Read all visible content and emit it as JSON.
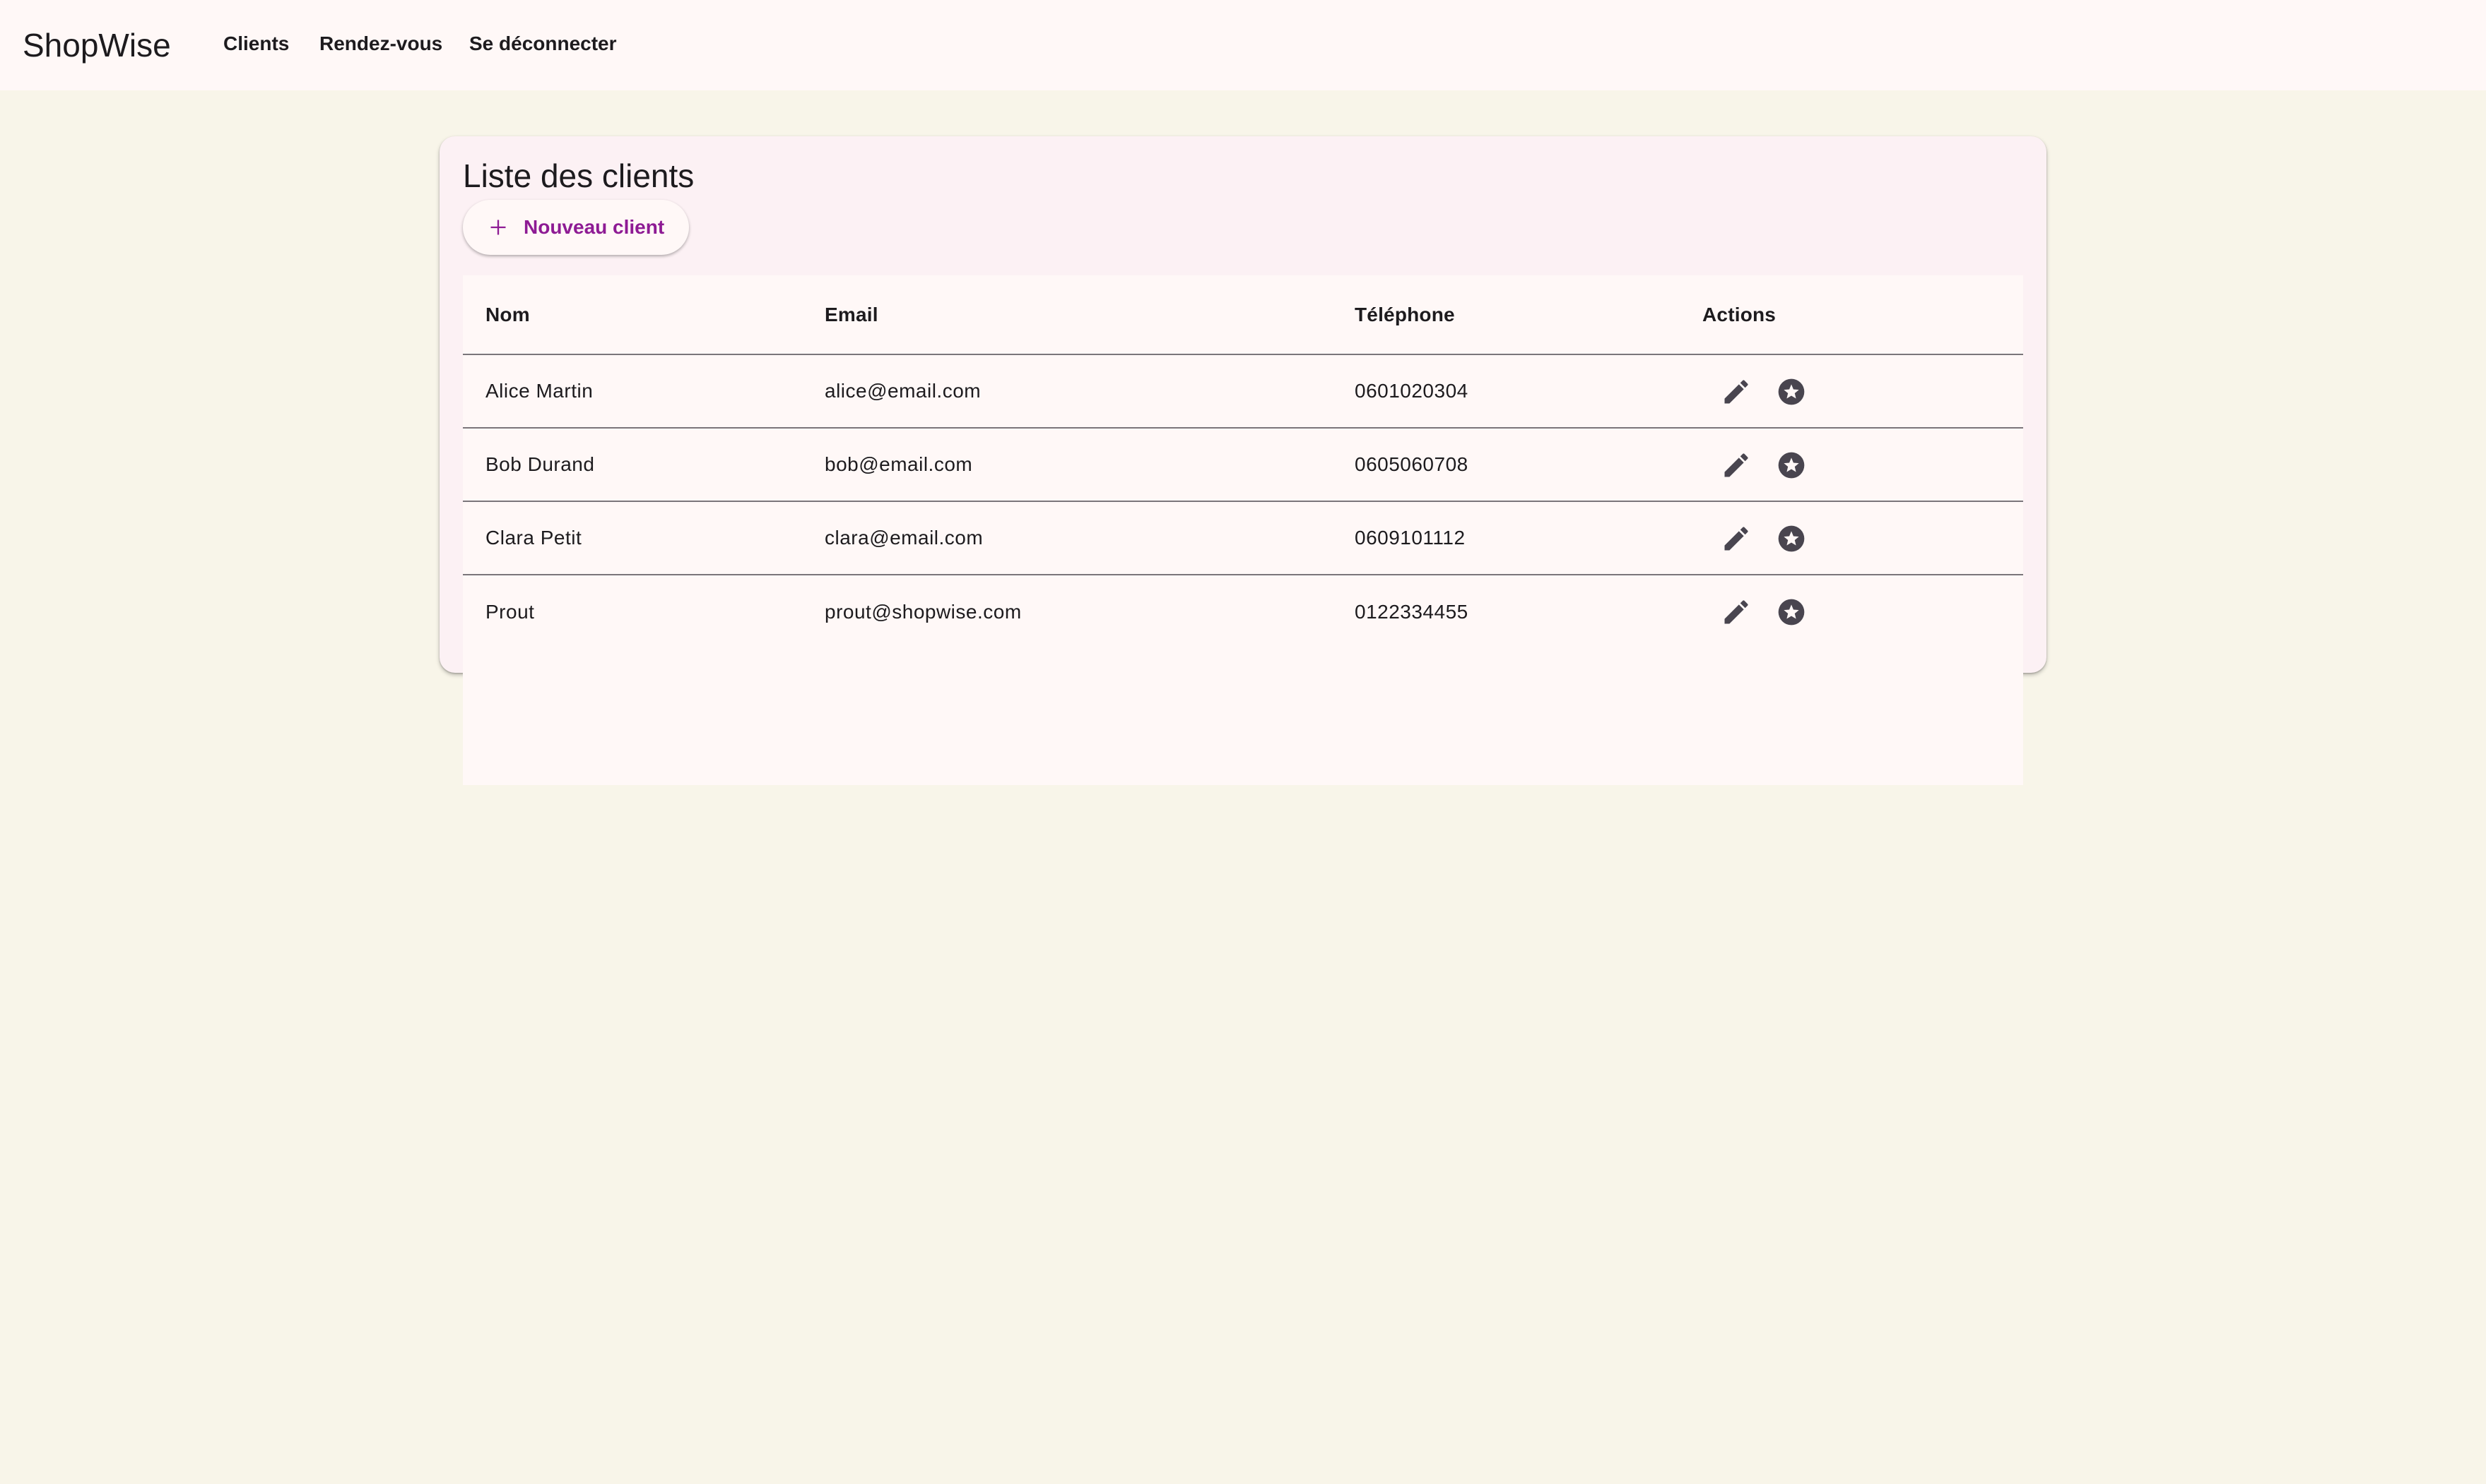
{
  "app": {
    "brand": "ShopWise"
  },
  "nav": {
    "clients": "Clients",
    "appointments": "Rendez-vous",
    "logout": "Se déconnecter"
  },
  "page": {
    "title": "Liste des clients",
    "new_client_label": "Nouveau client"
  },
  "table": {
    "columns": [
      "Nom",
      "Email",
      "Téléphone",
      "Actions"
    ],
    "rows": [
      {
        "nom": "Alice Martin",
        "email": "alice@email.com",
        "telephone": "0601020304"
      },
      {
        "nom": "Bob Durand",
        "email": "bob@email.com",
        "telephone": "0605060708"
      },
      {
        "nom": "Clara Petit",
        "email": "clara@email.com",
        "telephone": "0609101112"
      },
      {
        "nom": "Prout",
        "email": "prout@shopwise.com",
        "telephone": "0122334455"
      }
    ]
  },
  "icons": {
    "add": "plus-icon",
    "edit": "pencil-icon",
    "favorite": "star-circle-icon"
  },
  "colors": {
    "accent": "#8e1b94",
    "background": "#f8f5e9",
    "surface": "#fff8f7",
    "card": "#fcf1f4",
    "icon": "#49454f"
  }
}
